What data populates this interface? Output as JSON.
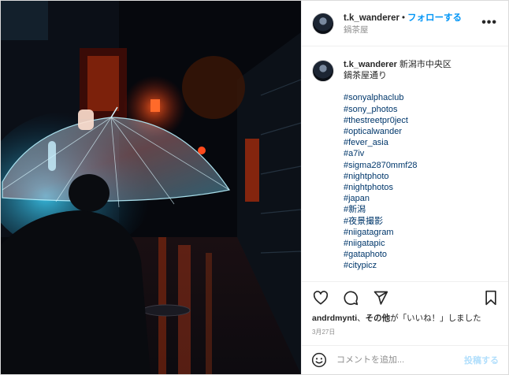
{
  "post": {
    "username": "t.k_wanderer",
    "separator": "•",
    "follow_label": "フォローする",
    "location": "鍋茶屋",
    "more_label": "•••"
  },
  "caption": {
    "username": "t.k_wanderer",
    "line1": "新潟市中央区",
    "line2": "鍋茶屋通り",
    "hashtags": [
      "#sonyalphaclub",
      "#sony_photos",
      "#thestreetpr0ject",
      "#opticalwander",
      "#fever_asia",
      "#a7iv",
      "#sigma2870mmf28",
      "#nightphoto",
      "#nightphotos",
      "#japan",
      "#新潟",
      "#夜景撮影",
      "#niigatagram",
      "#niigatapic",
      "#gataphoto",
      "#citypicz"
    ]
  },
  "actions": {
    "like_icon": "heart-icon",
    "comment_icon": "comment-icon",
    "share_icon": "paper-plane-icon",
    "save_icon": "bookmark-icon"
  },
  "likes": {
    "first_user": "andrdmynti",
    "connector": "、",
    "others": "その他",
    "suffix": "が「いいね！」しました"
  },
  "date": "3月27日",
  "comment": {
    "placeholder": "コメントを追加...",
    "post_label": "投稿する",
    "emoji_icon": "smiley-icon"
  },
  "colors": {
    "accent": "#0095f6",
    "post_disabled": "#b2dffc",
    "hashtag": "#00376b",
    "muted": "#8e8e8e"
  }
}
